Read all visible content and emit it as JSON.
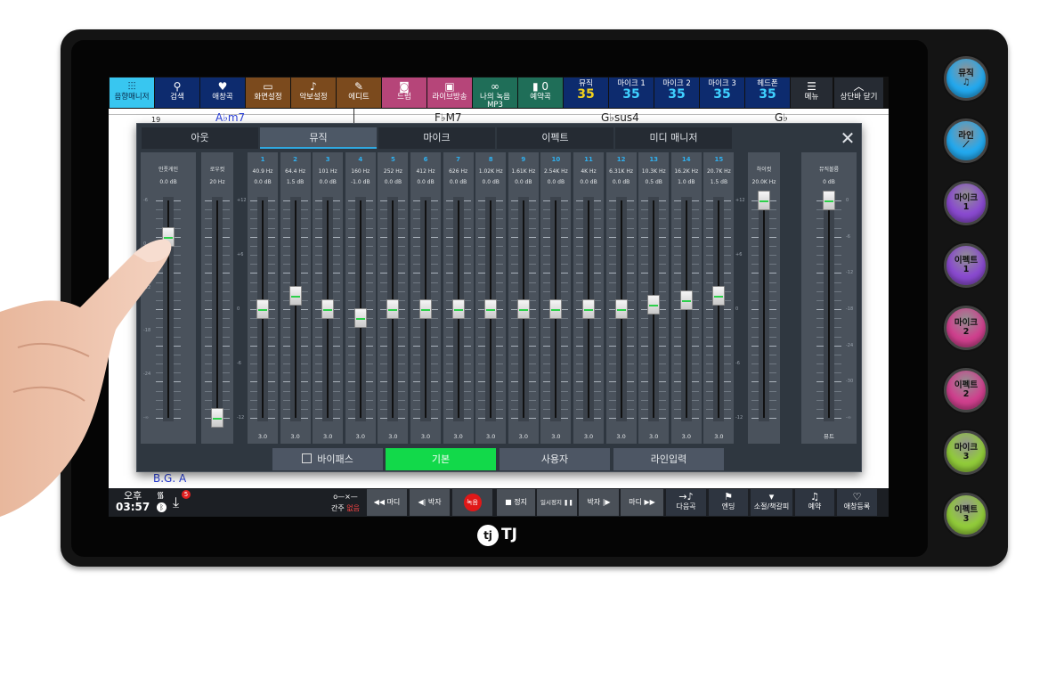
{
  "topbar": [
    {
      "icon": "mixer-icon",
      "glyph": "⫶⫶⫶",
      "label": "음향매니저",
      "color": "#38c6f0",
      "active": true
    },
    {
      "icon": "search-icon",
      "glyph": "⚲",
      "label": "검색",
      "color": "#0d2b6e"
    },
    {
      "icon": "heart-icon",
      "glyph": "♥",
      "label": "애창곡",
      "color": "#0d2b6e"
    },
    {
      "icon": "monitor-icon",
      "glyph": "▭",
      "label": "화면설정",
      "color": "#7b4a1d"
    },
    {
      "icon": "sheet-music-icon",
      "glyph": "♪",
      "label": "악보설정",
      "color": "#7b4a1d"
    },
    {
      "icon": "edit-icon",
      "glyph": "✎",
      "label": "에디트",
      "color": "#7b4a1d"
    },
    {
      "icon": "drum-icon",
      "glyph": "◙",
      "label": "드럼",
      "color": "#b64579"
    },
    {
      "icon": "live-broadcast-icon",
      "glyph": "▣",
      "label": "라이브방송",
      "color": "#b64579"
    },
    {
      "icon": "recording-icon",
      "glyph": "∞",
      "label": "나의 녹음MP3",
      "color": "#1f6e58"
    },
    {
      "icon": "reserved-songs-icon",
      "glyph": "▮ 0",
      "label": "예약곡",
      "color": "#1f6e58"
    }
  ],
  "volumes": [
    {
      "label": "뮤직",
      "value": "35",
      "highlight": "#f2d21b"
    },
    {
      "label": "마이크 1",
      "value": "35"
    },
    {
      "label": "마이크 2",
      "value": "35"
    },
    {
      "label": "마이크 3",
      "value": "35"
    },
    {
      "label": "헤드폰",
      "value": "35"
    }
  ],
  "menu_label": "메뉴",
  "close_topbar_label": "상단바 닫기",
  "score": {
    "measure": "19",
    "chords": [
      "A♭m7",
      "F♭M7",
      "G♭sus4",
      "G♭"
    ],
    "section": "B.G. A"
  },
  "mixer": {
    "tabs": [
      "아웃",
      "뮤직",
      "마이크",
      "이펙트",
      "미디 매니저"
    ],
    "active_tab": 1,
    "input_gain": {
      "label": "인풋게인",
      "value": "0.0 dB",
      "scale": [
        "-6",
        "0",
        "-12",
        "-18",
        "-24",
        "-∞"
      ],
      "level": 0.83
    },
    "low_cut": {
      "label": "로우컷",
      "value": "20 Hz",
      "level": 0.0
    },
    "eq_scale": [
      "+12",
      "+6",
      "0",
      "-6",
      "-12"
    ],
    "eq_range": [
      -12,
      12
    ],
    "bands": [
      {
        "n": "1",
        "freq": "40.9 Hz",
        "gain": "0.0 dB",
        "db": 0.0,
        "q": "3.0"
      },
      {
        "n": "2",
        "freq": "64.4 Hz",
        "gain": "1.5 dB",
        "db": 1.5,
        "q": "3.0"
      },
      {
        "n": "3",
        "freq": "101 Hz",
        "gain": "0.0 dB",
        "db": 0.0,
        "q": "3.0"
      },
      {
        "n": "4",
        "freq": "160 Hz",
        "gain": "-1.0 dB",
        "db": -1.0,
        "q": "3.0"
      },
      {
        "n": "5",
        "freq": "252 Hz",
        "gain": "0.0 dB",
        "db": 0.0,
        "q": "3.0"
      },
      {
        "n": "6",
        "freq": "412 Hz",
        "gain": "0.0 dB",
        "db": 0.0,
        "q": "3.0"
      },
      {
        "n": "7",
        "freq": "626 Hz",
        "gain": "0.0 dB",
        "db": 0.0,
        "q": "3.0"
      },
      {
        "n": "8",
        "freq": "1.02K Hz",
        "gain": "0.0 dB",
        "db": 0.0,
        "q": "3.0"
      },
      {
        "n": "9",
        "freq": "1.61K Hz",
        "gain": "0.0 dB",
        "db": 0.0,
        "q": "3.0"
      },
      {
        "n": "10",
        "freq": "2.54K Hz",
        "gain": "0.0 dB",
        "db": 0.0,
        "q": "3.0"
      },
      {
        "n": "11",
        "freq": "4K Hz",
        "gain": "0.0 dB",
        "db": 0.0,
        "q": "3.0"
      },
      {
        "n": "12",
        "freq": "6.31K Hz",
        "gain": "0.0 dB",
        "db": 0.0,
        "q": "3.0"
      },
      {
        "n": "13",
        "freq": "10.3K Hz",
        "gain": "0.5 dB",
        "db": 0.5,
        "q": "3.0"
      },
      {
        "n": "14",
        "freq": "16.2K Hz",
        "gain": "1.0 dB",
        "db": 1.0,
        "q": "3.0"
      },
      {
        "n": "15",
        "freq": "20.7K Hz",
        "gain": "1.5 dB",
        "db": 1.5,
        "q": "3.0"
      }
    ],
    "high_cut": {
      "label": "하이컷",
      "value": "20.0K Hz",
      "level": 1.0
    },
    "music_volume": {
      "label": "뮤직볼륨",
      "value": "0 dB",
      "scale": [
        "0",
        "-6",
        "-12",
        "-18",
        "-24",
        "-30",
        "-∞"
      ],
      "level": 1.0,
      "footer": "뮤트"
    },
    "presets": {
      "bypass": "바이패스",
      "basic": "기본",
      "user": "사용자",
      "line_input": "라인입력",
      "active": "basic"
    }
  },
  "status": {
    "ampm": "오후",
    "time": "03:57",
    "download_badge": "5"
  },
  "transport": {
    "intro_skip": "간주",
    "intro_state": "없음",
    "prev_bar": "마디",
    "prev_beat": "박자",
    "record": "녹음",
    "stop": "정지",
    "pause": "일시정지",
    "next_beat": "박자",
    "next_bar": "마디",
    "next_song": "다음곡",
    "ending": "엔딩",
    "bookmark": "소절/책갈피",
    "reserve": "예약",
    "add_favorite": "애창등록"
  },
  "side_buttons": [
    {
      "label": "뮤직",
      "sub": "♫",
      "color": "#23a9ef"
    },
    {
      "label": "라인",
      "sub": "⟋",
      "color": "#23a9ef"
    },
    {
      "label": "마이크",
      "sub": "1",
      "color": "#8a4ad0"
    },
    {
      "label": "이펙트",
      "sub": "1",
      "color": "#8a4ad0"
    },
    {
      "label": "마이크",
      "sub": "2",
      "color": "#d0408e"
    },
    {
      "label": "이펙트",
      "sub": "2",
      "color": "#d0408e"
    },
    {
      "label": "마이크",
      "sub": "3",
      "color": "#92cc3a"
    },
    {
      "label": "이펙트",
      "sub": "3",
      "color": "#92cc3a"
    }
  ],
  "brand": "TJ"
}
